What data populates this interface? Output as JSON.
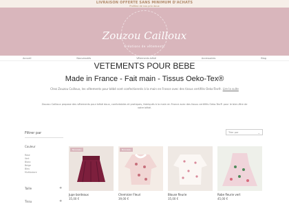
{
  "topbar": {
    "line1": "LIVRAISON OFFERTE SANS MINIMUM D'ACHATS",
    "line2": "Profitez de nos prix doux"
  },
  "hero": {
    "logo": "Zouzou Cailloux",
    "tagline": "Créations de vêtements"
  },
  "nav": [
    "Accueil",
    "Nouveautés",
    "Vêtements bébé",
    "Accessoires",
    "Blog"
  ],
  "page": {
    "title": "VETEMENTS POUR BEBE",
    "subtitle": "Made in France - Fait main - Tissus Oeko-Tex®",
    "intro": "Chez Zouzou Cailloux, les vêtements pour bébé sont confectionnés à la main en France avec des tissus certifiés Oeko-Tex®.",
    "intro_link": "Lire la suite",
    "description": "Zouzou Cailloux propose des vêtements pour bébé doux, confortables et pratiques, fabriqués à la main en France avec des tissus certifiés Oeko-Tex® pour le bien-être de votre bébé."
  },
  "filters": {
    "title": "Filtrer par",
    "facets": [
      {
        "label": "Couleur",
        "options": [
          "Rose",
          "Vert",
          "Blanc",
          "Beige",
          "Bleu",
          "Multicolore"
        ]
      },
      {
        "label": "Taille"
      },
      {
        "label": "Tissu"
      }
    ]
  },
  "sort": {
    "label": "Trier par"
  },
  "products": [
    {
      "name": "Jupe bordeaux",
      "price": "35,00 €",
      "badge": "Nouveau"
    },
    {
      "name": "Chemisier Fleuri",
      "price": "39,00 €",
      "badge": "Nouveau"
    },
    {
      "name": "Blouse fleurie",
      "price": "35,00 €",
      "badge": ""
    },
    {
      "name": "Robe fleurie vert",
      "price": "45,00 €",
      "badge": ""
    }
  ],
  "colors": {
    "hero": "#d9b6bc",
    "topbar": "#f6eee8",
    "accent": "#b08a6a"
  }
}
